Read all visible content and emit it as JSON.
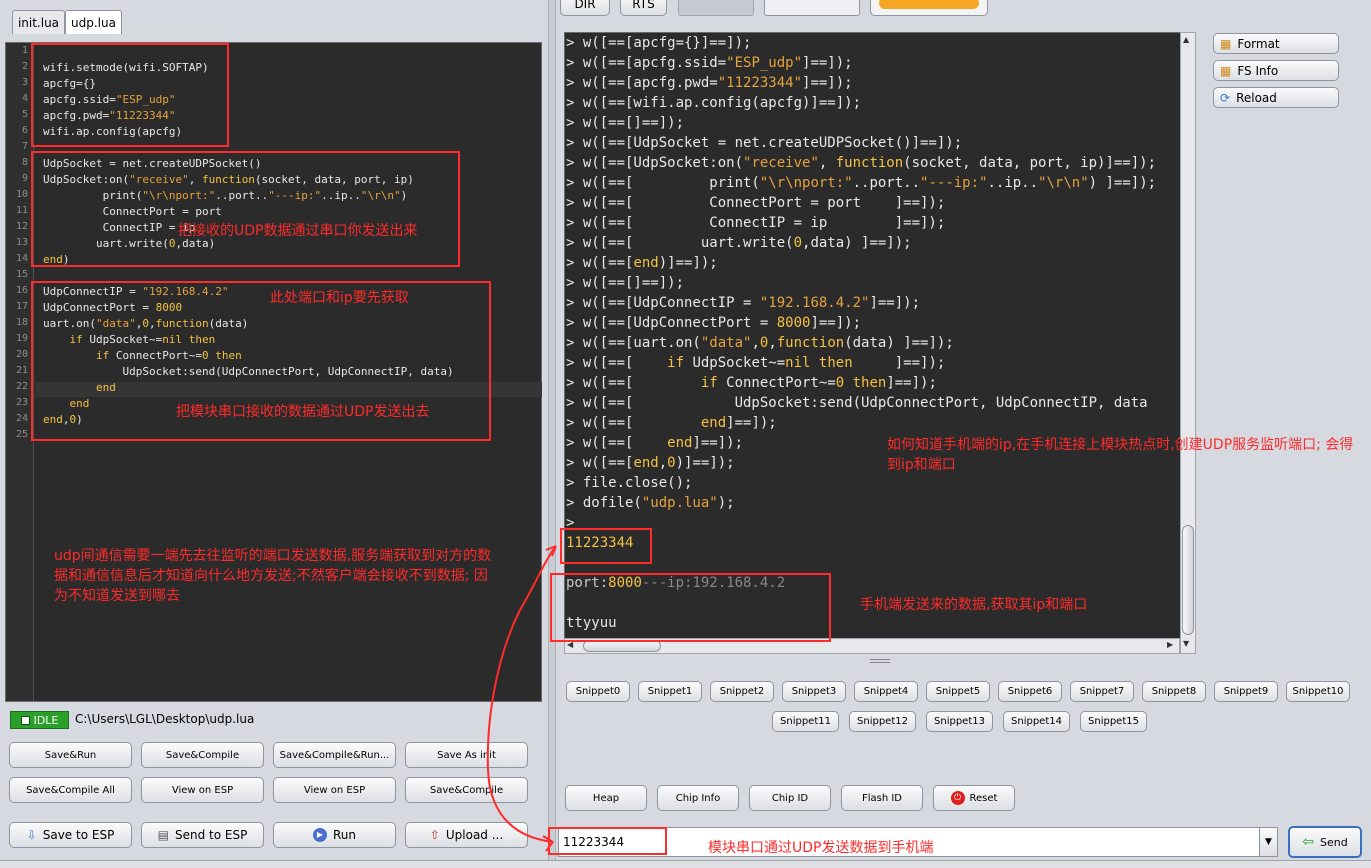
{
  "tabs": [
    "init.lua",
    "udp.lua"
  ],
  "editor": {
    "line_numbers": [
      "1",
      "2",
      "3",
      "4",
      "5",
      "6",
      "7",
      "8",
      "9",
      "10",
      "11",
      "12",
      "13",
      "14",
      "15",
      "16",
      "17",
      "18",
      "19",
      "20",
      "21",
      "22",
      "23",
      "24",
      "25"
    ]
  },
  "status": {
    "badge": "IDLE",
    "path": "C:\\Users\\LGL\\Desktop\\udp.lua"
  },
  "left_buttons": {
    "row1": [
      "Save&Run",
      "Save&Compile",
      "Save&Compile&Run...",
      "Save As init"
    ],
    "row2": [
      "Save&Compile All",
      "View on ESP",
      "View on ESP",
      "Save&Compile"
    ],
    "row3": [
      "Save to ESP",
      "Send to ESP",
      "Run",
      "Upload ..."
    ]
  },
  "top_buttons": [
    "DIR",
    "RTS"
  ],
  "side_buttons": [
    "Format",
    "FS Info",
    "Reload"
  ],
  "snippets_row1": [
    "Snippet0",
    "Snippet1",
    "Snippet2",
    "Snippet3",
    "Snippet4",
    "Snippet5",
    "Snippet6",
    "Snippet7",
    "Snippet8",
    "Snippet9",
    "Snippet10"
  ],
  "snippets_row2": [
    "Snippet11",
    "Snippet12",
    "Snippet13",
    "Snippet14",
    "Snippet15"
  ],
  "bottom_buttons": [
    "Heap",
    "Chip Info",
    "Chip ID",
    "Flash ID",
    "Reset"
  ],
  "command_input": "11223344",
  "send_label": "Send",
  "terminal": {
    "prompt": ">",
    "out_value": "11223344",
    "port_prefix": "port:",
    "port_value": "8000",
    "ip_prefix": "---ip:",
    "ip_value": "192.168.4.2",
    "last_line": "ttyyuu"
  },
  "annotations": {
    "a1": "把接收的UDP数据通过串口你发送出来",
    "a2": "此处端口和ip要先获取",
    "a3": "把模块串口接收的数据通过UDP发送出去",
    "a4": "udp间通信需要一端先去往监听的端口发送数据,服务端获取到对方的数据和通信信息后才知道向什么地方发送;不然客户端会接收不到数据; 因为不知道发送到哪去",
    "a5": "如何知道手机端的ip,在手机连接上模块热点时,创建UDP服务监听端口; 会得到ip和端口",
    "a6": "手机端发送来的数据,获取其ip和端口",
    "a7": "模块串口通过UDP发送数据到手机端"
  },
  "colors": {
    "annotation": "#ff2a2a",
    "idle": "#2aa02a",
    "code_string": "#e6a23c",
    "code_keyword": "#f5c242"
  }
}
